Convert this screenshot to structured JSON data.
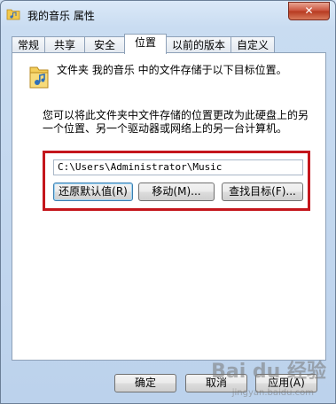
{
  "window": {
    "title": "我的音乐 属性",
    "close_label": "✕"
  },
  "tabs": [
    {
      "label": "常规"
    },
    {
      "label": "共享"
    },
    {
      "label": "安全"
    },
    {
      "label": "位置",
      "active": true
    },
    {
      "label": "以前的版本"
    },
    {
      "label": "自定义"
    }
  ],
  "location": {
    "description": "文件夹 我的音乐 中的文件存储于以下目标位置。",
    "info": "您可以将此文件夹中文件存储的位置更改为此硬盘上的另一个位置、另一个驱动器或网络上的另一台计算机。",
    "path_value": "C:\\Users\\Administrator\\Music",
    "restore_label": "还原默认值(R)",
    "move_label": "移动(M)...",
    "find_label": "查找目标(F)..."
  },
  "footer": {
    "ok_label": "确定",
    "cancel_label": "取消",
    "apply_label": "应用(A)"
  },
  "watermark": {
    "brand": "Bai du 经验",
    "url": "jingyan.baidu.com"
  },
  "colors": {
    "highlight_box": "#c4161c",
    "window_bg": "#c9dcf1"
  },
  "icons": {
    "title": "music-folder-icon",
    "folder": "music-folder-icon"
  }
}
